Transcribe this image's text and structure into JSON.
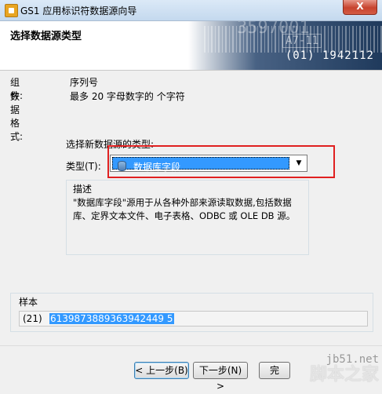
{
  "window": {
    "title": "GS1 应用标识符数据源向导",
    "close_label": "X"
  },
  "header": {
    "title": "选择数据源类型",
    "barcode_large": "3597001",
    "barcode_mid": "A7-11",
    "barcode_text": "(01) 1942112"
  },
  "info": {
    "component_label": "组件:",
    "component_value": "序列号",
    "format_label": "数据格式:",
    "format_value": "最多 20 字母数字的 个字符"
  },
  "type_section": {
    "heading": "选择新数据源的类型:",
    "type_label": "类型(T):",
    "selected_value": "数据库字段"
  },
  "description": {
    "legend": "描述",
    "text": "\"数据库字段\"源用于从各种外部来源读取数据,包括数据库、定界文本文件、电子表格、ODBC 或 OLE DB 源。"
  },
  "sample": {
    "legend": "样本",
    "prefix": "(21)",
    "value": "6139873889363942449 5"
  },
  "buttons": {
    "back": "< 上一步(B)",
    "next": "下一步(N) >",
    "finish": "完"
  },
  "watermark": {
    "domain": "jb51.net",
    "name": "脚本之家"
  },
  "colors": {
    "selection": "#3399ff",
    "highlight_box": "#e02020"
  }
}
